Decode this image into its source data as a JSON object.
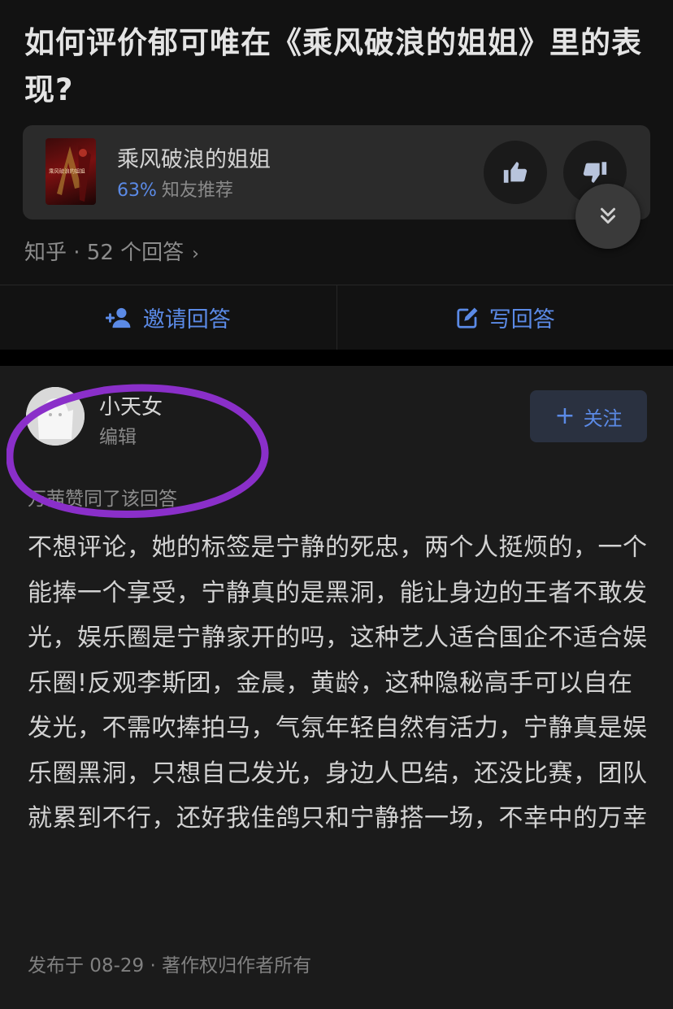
{
  "question": {
    "title": "如何评价郁可唯在《乘风破浪的姐姐》里的表现?"
  },
  "topic": {
    "name": "乘风破浪的姐姐",
    "cover_text": "乘风破浪的姐姐",
    "rating_percent": "63%",
    "rating_label": "知友推荐",
    "icons": {
      "like": "thumbs-up-icon",
      "dislike": "thumbs-down-icon",
      "expand": "double-chevron-down-icon"
    }
  },
  "meta": {
    "source": "知乎 · 52 个回答",
    "chevron": "›"
  },
  "actions": {
    "invite_label": "邀请回答",
    "write_label": "写回答",
    "icons": {
      "invite": "add-user-icon",
      "write": "edit-icon"
    }
  },
  "answer": {
    "author": {
      "name": "小天女",
      "tag": "编辑"
    },
    "follow_label": "关注",
    "follow_plus": "+",
    "endorsement": "万茜赞同了该回答",
    "body": "不想评论，她的标签是宁静的死忠，两个人挺烦的，一个能捧一个享受，宁静真的是黑洞，能让身边的王者不敢发光，娱乐圈是宁静家开的吗，这种艺人适合国企不适合娱乐圈!反观李斯团，金晨，黄龄，这种隐秘高手可以自在发光，不需吹捧拍马，气氛年轻自然有活力，宁静真是娱乐圈黑洞，只想自己发光，身边人巴结，还没比赛，团队就累到不行，还好我佳鸽只和宁静搭一场，不幸中的万幸",
    "footer": "发布于 08-29 · 著作权归作者所有"
  },
  "colors": {
    "accent": "#5b8ae6",
    "highlight_ring": "#8a2fc9",
    "background": "#121212",
    "card": "#2b2b2b"
  }
}
